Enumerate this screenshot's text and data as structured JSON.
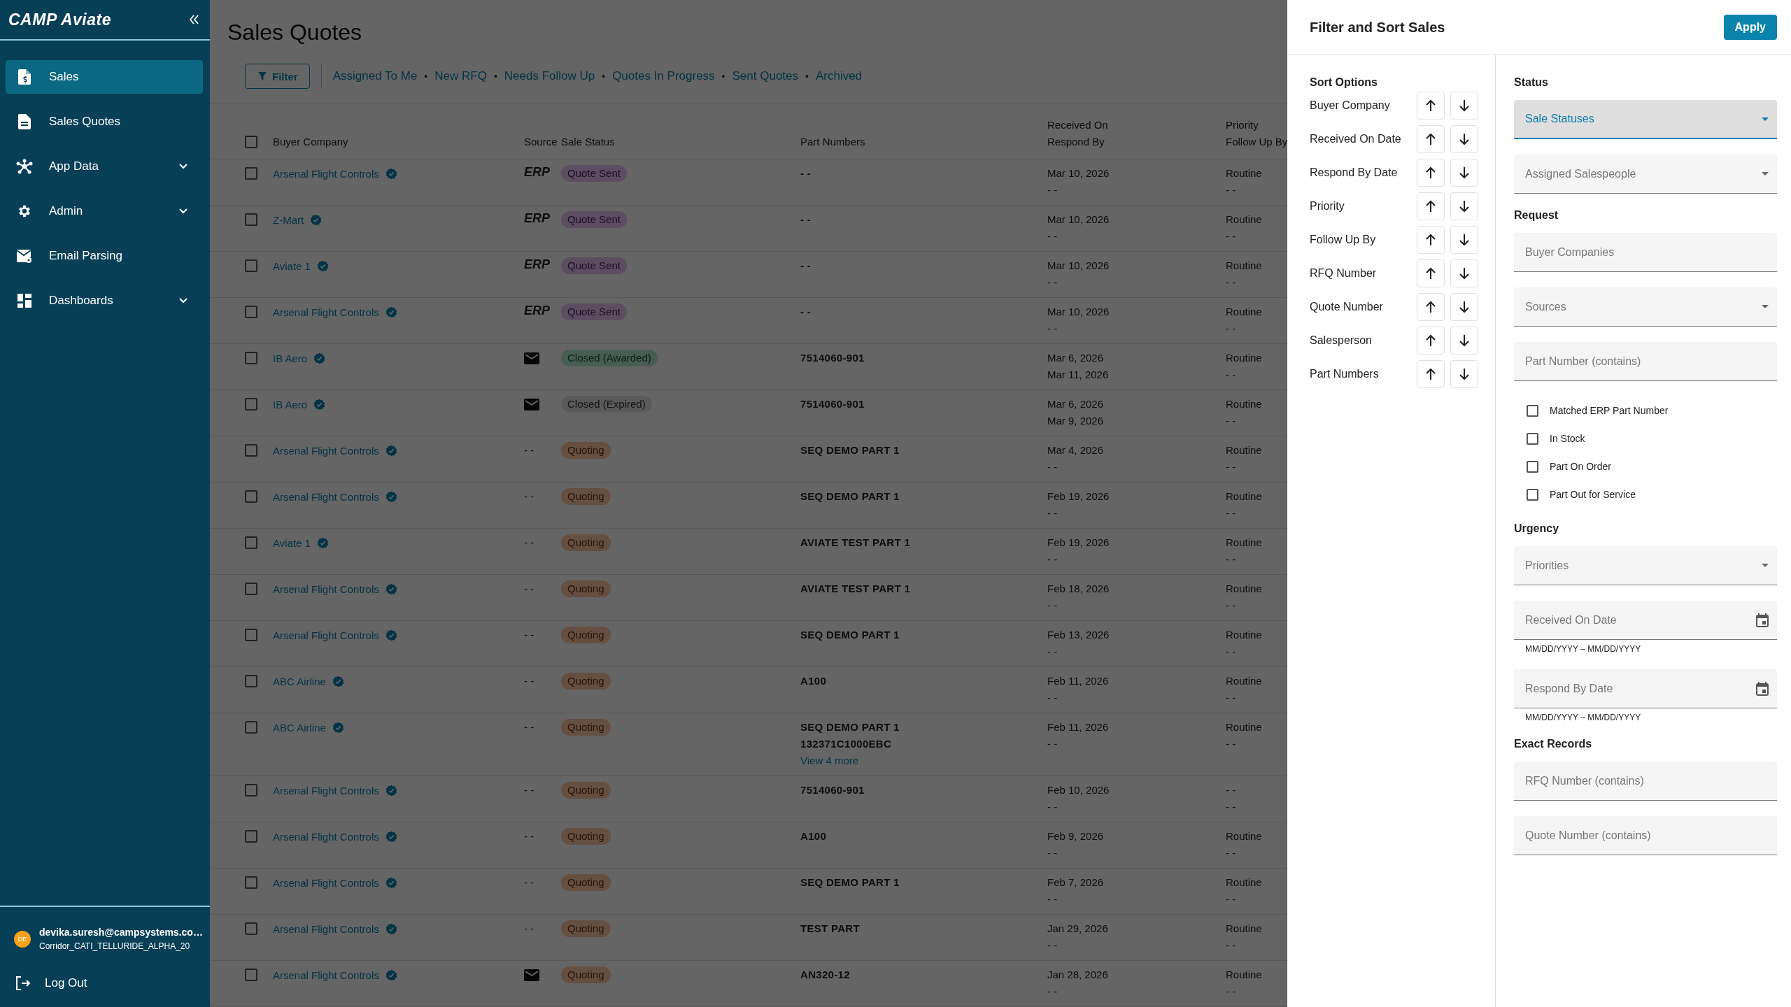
{
  "sidebar": {
    "logo": "CAMP Aviate",
    "items": [
      {
        "label": "Sales",
        "selected": true,
        "expandable": false
      },
      {
        "label": "Sales Quotes",
        "selected": false,
        "expandable": false
      },
      {
        "label": "App Data",
        "selected": false,
        "expandable": true
      },
      {
        "label": "Admin",
        "selected": false,
        "expandable": true
      },
      {
        "label": "Email Parsing",
        "selected": false,
        "expandable": false
      },
      {
        "label": "Dashboards",
        "selected": false,
        "expandable": true
      }
    ],
    "user": {
      "initials": "DE",
      "email": "devika.suresh@campsystems.co…",
      "org": "Corridor_CATI_TELLURIDE_ALPHA_20"
    },
    "logout": "Log Out"
  },
  "main": {
    "title": "Sales Quotes",
    "filter_button": "Filter",
    "quick_filters": [
      "Assigned To Me",
      "New RFQ",
      "Needs Follow Up",
      "Quotes In Progress",
      "Sent Quotes",
      "Archived"
    ],
    "separator": "•"
  },
  "table": {
    "select_all_checked": false,
    "columns": [
      {
        "label": "Buyer Company"
      },
      {
        "label": "Source"
      },
      {
        "label": "Sale Status"
      },
      {
        "label": "Part Numbers"
      },
      {
        "label": "Received On",
        "label_2": "Respond By"
      },
      {
        "label": "Priority",
        "label_2": "Follow Up By"
      }
    ],
    "rows": [
      {
        "checked": false,
        "company": "Arsenal Flight Controls",
        "verified": true,
        "source": {
          "kind": "erp",
          "text": "ERP"
        },
        "status": {
          "kind": "sent",
          "label": "Quote Sent"
        },
        "parts": [
          "- -"
        ],
        "received": "Mar 10, 2026",
        "respond": "- -",
        "priority": "Routine",
        "follow_up": "- -"
      },
      {
        "checked": false,
        "company": "Z-Mart",
        "verified": true,
        "source": {
          "kind": "erp",
          "text": "ERP"
        },
        "status": {
          "kind": "sent",
          "label": "Quote Sent"
        },
        "parts": [
          "- -"
        ],
        "received": "Mar 10, 2026",
        "respond": "- -",
        "priority": "Routine",
        "follow_up": "- -"
      },
      {
        "checked": false,
        "company": "Aviate 1",
        "verified": true,
        "source": {
          "kind": "erp",
          "text": "ERP"
        },
        "status": {
          "kind": "sent",
          "label": "Quote Sent"
        },
        "parts": [
          "- -"
        ],
        "received": "Mar 10, 2026",
        "respond": "- -",
        "priority": "Routine",
        "follow_up": "- -"
      },
      {
        "checked": false,
        "company": "Arsenal Flight Controls",
        "verified": true,
        "source": {
          "kind": "erp",
          "text": "ERP"
        },
        "status": {
          "kind": "sent",
          "label": "Quote Sent"
        },
        "parts": [
          "- -"
        ],
        "received": "Mar 10, 2026",
        "respond": "- -",
        "priority": "Routine",
        "follow_up": "- -"
      },
      {
        "checked": false,
        "company": "IB Aero",
        "verified": true,
        "source": {
          "kind": "email"
        },
        "status": {
          "kind": "awarded",
          "label": "Closed (Awarded)"
        },
        "parts": [
          "7514060-901"
        ],
        "received": "Mar 6, 2026",
        "respond": "Mar 11, 2026",
        "priority": "Routine",
        "follow_up": "- -"
      },
      {
        "checked": false,
        "company": "IB Aero",
        "verified": true,
        "source": {
          "kind": "email"
        },
        "status": {
          "kind": "expired",
          "label": "Closed (Expired)"
        },
        "parts": [
          "7514060-901"
        ],
        "received": "Mar 6, 2026",
        "respond": "Mar 9, 2026",
        "priority": "Routine",
        "follow_up": "- -"
      },
      {
        "checked": false,
        "company": "Arsenal Flight Controls",
        "verified": true,
        "source": {
          "kind": "none",
          "text": "- -"
        },
        "status": {
          "kind": "quoting",
          "label": "Quoting"
        },
        "parts": [
          "SEQ DEMO PART 1"
        ],
        "received": "Mar 4, 2026",
        "respond": "- -",
        "priority": "Routine",
        "follow_up": "- -"
      },
      {
        "checked": false,
        "company": "Arsenal Flight Controls",
        "verified": true,
        "source": {
          "kind": "none",
          "text": "- -"
        },
        "status": {
          "kind": "quoting",
          "label": "Quoting"
        },
        "parts": [
          "SEQ DEMO PART 1"
        ],
        "received": "Feb 19, 2026",
        "respond": "- -",
        "priority": "Routine",
        "follow_up": "- -"
      },
      {
        "checked": false,
        "company": "Aviate 1",
        "verified": true,
        "source": {
          "kind": "none",
          "text": "- -"
        },
        "status": {
          "kind": "quoting",
          "label": "Quoting"
        },
        "parts": [
          "AVIATE TEST PART 1"
        ],
        "received": "Feb 19, 2026",
        "respond": "- -",
        "priority": "Routine",
        "follow_up": "- -"
      },
      {
        "checked": false,
        "company": "Arsenal Flight Controls",
        "verified": true,
        "source": {
          "kind": "none",
          "text": "- -"
        },
        "status": {
          "kind": "quoting",
          "label": "Quoting"
        },
        "parts": [
          "AVIATE TEST PART 1"
        ],
        "received": "Feb 18, 2026",
        "respond": "- -",
        "priority": "Routine",
        "follow_up": "- -"
      },
      {
        "checked": false,
        "company": "Arsenal Flight Controls",
        "verified": true,
        "source": {
          "kind": "none",
          "text": "- -"
        },
        "status": {
          "kind": "quoting",
          "label": "Quoting"
        },
        "parts": [
          "SEQ DEMO PART 1"
        ],
        "received": "Feb 13, 2026",
        "respond": "- -",
        "priority": "Routine",
        "follow_up": "- -"
      },
      {
        "checked": false,
        "company": "ABC Airline",
        "verified": true,
        "source": {
          "kind": "none",
          "text": "- -"
        },
        "status": {
          "kind": "quoting",
          "label": "Quoting"
        },
        "parts": [
          "A100"
        ],
        "received": "Feb 11, 2026",
        "respond": "- -",
        "priority": "Routine",
        "follow_up": "- -"
      },
      {
        "checked": false,
        "company": "ABC Airline",
        "verified": true,
        "source": {
          "kind": "none",
          "text": "- -"
        },
        "status": {
          "kind": "quoting",
          "label": "Quoting"
        },
        "parts": [
          "SEQ DEMO PART 1",
          "132371C1000EBC"
        ],
        "more_link": "View 4 more",
        "received": "Feb 11, 2026",
        "respond": "- -",
        "priority": "Routine",
        "follow_up": "- -"
      },
      {
        "checked": false,
        "company": "Arsenal Flight Controls",
        "verified": true,
        "source": {
          "kind": "none",
          "text": "- -"
        },
        "status": {
          "kind": "quoting",
          "label": "Quoting"
        },
        "parts": [
          "7514060-901"
        ],
        "received": "Feb 10, 2026",
        "respond": "- -",
        "priority": "- -",
        "follow_up": "- -"
      },
      {
        "checked": false,
        "company": "Arsenal Flight Controls",
        "verified": true,
        "source": {
          "kind": "none",
          "text": "- -"
        },
        "status": {
          "kind": "quoting",
          "label": "Quoting"
        },
        "parts": [
          "A100"
        ],
        "received": "Feb 9, 2026",
        "respond": "- -",
        "priority": "Routine",
        "follow_up": "- -"
      },
      {
        "checked": false,
        "company": "Arsenal Flight Controls",
        "verified": true,
        "source": {
          "kind": "none",
          "text": "- -"
        },
        "status": {
          "kind": "quoting",
          "label": "Quoting"
        },
        "parts": [
          "SEQ DEMO PART 1"
        ],
        "received": "Feb 7, 2026",
        "respond": "- -",
        "priority": "Routine",
        "follow_up": "- -"
      },
      {
        "checked": false,
        "company": "Arsenal Flight Controls",
        "verified": true,
        "source": {
          "kind": "none",
          "text": "- -"
        },
        "status": {
          "kind": "quoting",
          "label": "Quoting"
        },
        "parts": [
          "TEST PART"
        ],
        "received": "Jan 29, 2026",
        "respond": "- -",
        "priority": "Routine",
        "follow_up": "- -"
      },
      {
        "checked": false,
        "company": "Arsenal Flight Controls",
        "verified": true,
        "source": {
          "kind": "email"
        },
        "status": {
          "kind": "quoting",
          "label": "Quoting"
        },
        "parts": [
          "AN320-12"
        ],
        "received": "Jan 28, 2026",
        "respond": "- -",
        "priority": "Routine",
        "follow_up": "- -"
      }
    ]
  },
  "drawer": {
    "title": "Filter and Sort Sales",
    "apply_button": "Apply",
    "sort_title": "Sort Options",
    "sort_options": [
      "Buyer Company",
      "Received On Date",
      "Respond By Date",
      "Priority",
      "Follow Up By",
      "RFQ Number",
      "Quote Number",
      "Salesperson",
      "Part Numbers"
    ],
    "sections": [
      {
        "title": "Status",
        "items": [
          {
            "kind": "select",
            "placeholder": "Sale Statuses",
            "focused": true
          },
          {
            "kind": "select",
            "placeholder": "Assigned Salespeople",
            "focused": false
          }
        ]
      },
      {
        "title": "Request",
        "items": [
          {
            "kind": "text",
            "placeholder": "Buyer Companies",
            "focused": false
          },
          {
            "kind": "select",
            "placeholder": "Sources",
            "focused": false
          },
          {
            "kind": "text",
            "placeholder": "Part Number (contains)",
            "focused": false
          },
          {
            "kind": "checkbox",
            "label": "Matched ERP Part Number",
            "checked": false
          },
          {
            "kind": "checkbox",
            "label": "In Stock",
            "checked": false
          },
          {
            "kind": "checkbox",
            "label": "Part On Order",
            "checked": false
          },
          {
            "kind": "checkbox",
            "label": "Part Out for Service",
            "checked": false
          }
        ]
      },
      {
        "title": "Urgency",
        "items": [
          {
            "kind": "select",
            "placeholder": "Priorities",
            "focused": false
          },
          {
            "kind": "date",
            "placeholder": "Received On Date",
            "hint": "MM/DD/YYYY – MM/DD/YYYY",
            "focused": false
          },
          {
            "kind": "date",
            "placeholder": "Respond By Date",
            "hint": "MM/DD/YYYY – MM/DD/YYYY",
            "focused": false
          }
        ]
      },
      {
        "title": "Exact Records",
        "items": [
          {
            "kind": "text",
            "placeholder": "RFQ Number (contains)",
            "focused": false
          },
          {
            "kind": "text",
            "placeholder": "Quote Number (contains)",
            "focused": false
          }
        ]
      }
    ]
  }
}
